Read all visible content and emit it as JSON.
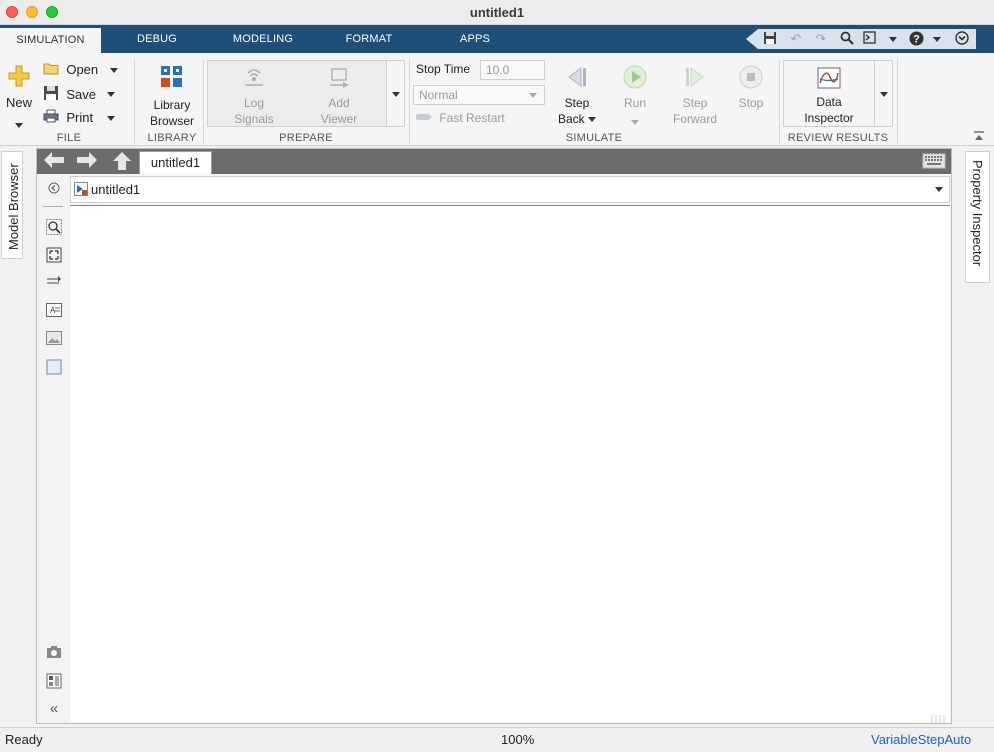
{
  "window": {
    "title": "untitled1"
  },
  "tabs": [
    {
      "label": "SIMULATION",
      "active": true
    },
    {
      "label": "DEBUG"
    },
    {
      "label": "MODELING"
    },
    {
      "label": "FORMAT"
    },
    {
      "label": "APPS"
    }
  ],
  "toolstrip": {
    "file": {
      "label": "FILE",
      "new": "New",
      "open": "Open",
      "save": "Save",
      "print": "Print"
    },
    "library": {
      "label": "LIBRARY",
      "browser_line1": "Library",
      "browser_line2": "Browser"
    },
    "prepare": {
      "label": "PREPARE",
      "log_line1": "Log",
      "log_line2": "Signals",
      "add_line1": "Add",
      "add_line2": "Viewer"
    },
    "simulate": {
      "label": "SIMULATE",
      "stop_time_label": "Stop Time",
      "stop_time_value": "10.0",
      "mode": "Normal",
      "fast_restart": "Fast Restart",
      "step_back_line1": "Step",
      "step_back_line2": "Back",
      "run": "Run",
      "step_forward_line1": "Step",
      "step_forward_line2": "Forward",
      "stop": "Stop"
    },
    "review": {
      "label": "REVIEW RESULTS",
      "di_line1": "Data",
      "di_line2": "Inspector"
    }
  },
  "left_panel": {
    "model_browser": "Model Browser"
  },
  "right_panel": {
    "property_inspector": "Property Inspector"
  },
  "editor": {
    "doc_tab": "untitled1",
    "address": "untitled1"
  },
  "status": {
    "state": "Ready",
    "zoom": "100%",
    "solver": "VariableStepAuto"
  },
  "colors": {
    "tabstrip": "#1f4e79",
    "solver_link": "#2060c0"
  }
}
